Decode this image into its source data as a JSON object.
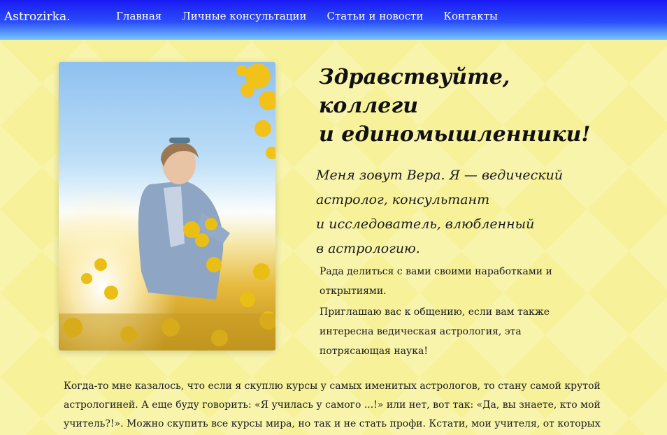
{
  "header": {
    "brand": "Astrozirka.",
    "nav": [
      {
        "label": "Главная"
      },
      {
        "label": "Личные консультации"
      },
      {
        "label": "Статьи и новости"
      },
      {
        "label": "Контакты"
      }
    ]
  },
  "hero": {
    "title_lines": [
      "Здравствуйте,",
      "коллеги",
      "и единомышленники!"
    ],
    "subtitle_lines": [
      "Меня зовут Вера. Я — ведический",
      "астролог, консультант",
      "и исследователь, влюбленный",
      "в астрологию."
    ],
    "paragraph1_lines": [
      "Рада делиться с вами своими наработками и",
      "открытиями."
    ],
    "paragraph2_lines": [
      "Приглашаю вас к общению, если вам также",
      "интересна ведическая астрология, эта",
      "потрясающая наука!"
    ]
  },
  "story": {
    "lines": [
      "Когда-то мне казалось, что если я скуплю курсы у самых именитых астрологов, то стану самой крутой",
      "астрологиней. А еще буду говорить: «Я училась у самого ...!» или нет, вот так: «Да, вы знаете, кто мой",
      "учитель?!». Можно скупить все курсы мира, но так и не стать профи. Кстати, мои учителя, от которых"
    ]
  },
  "colors": {
    "page_background": "#f7f29a",
    "nav_gradient_top": "#1a1af5",
    "nav_gradient_bottom": "#78c6f8",
    "nav_text": "#ffffff"
  }
}
